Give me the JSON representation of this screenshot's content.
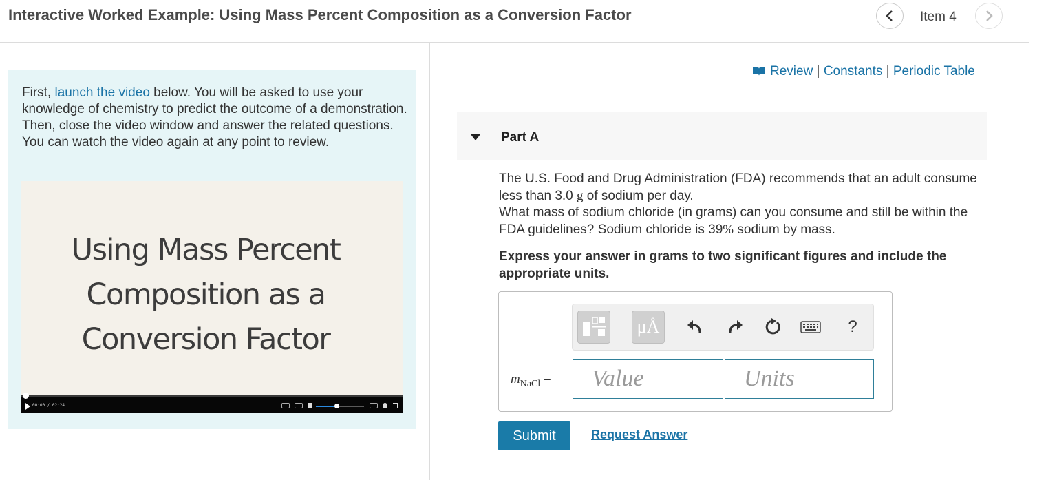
{
  "header": {
    "title": "Interactive Worked Example: Using Mass Percent Composition as a Conversion Factor",
    "item_label": "Item 4",
    "prev_icon": "chevron-left-icon",
    "next_icon": "chevron-right-icon"
  },
  "intro": {
    "text_before_link": "First, ",
    "link_text": "launch the video",
    "text_after_link": " below. You will be asked to use your knowledge of chemistry to predict the outcome of a demonstration. Then, close the video window and answer the related questions. You can watch the video again at any point to review."
  },
  "video": {
    "title_line1": "Using Mass Percent",
    "title_line2": "Composition as a",
    "title_line3": "Conversion Factor",
    "time": "00:00 / 02:24",
    "progress": 0.0,
    "volume": 0.43
  },
  "resources": {
    "icon": "book-icon",
    "review": "Review",
    "constants": "Constants",
    "periodic_table": "Periodic Table",
    "separator": "|"
  },
  "part": {
    "title": "Part A",
    "caret_icon": "caret-down-icon"
  },
  "question": {
    "line1_pre": "The U.S. Food and Drug Administration (FDA) recommends that an adult consume less than 3.0 ",
    "unit_g": "g",
    "line1_post": " of sodium per day.",
    "line2_pre": "What mass of sodium chloride (in grams) can you consume and still be within the FDA guidelines? Sodium chloride is 39",
    "percent": "%",
    "line2_post": " sodium by mass."
  },
  "instruction": "Express your answer in grams to two significant figures and include the appropriate units.",
  "toolbar": {
    "units_label": "μÅ",
    "help_label": "?",
    "icons": [
      "templates-icon",
      "units-icon",
      "undo-icon",
      "redo-icon",
      "reset-icon",
      "keyboard-icon",
      "help-icon"
    ]
  },
  "answer": {
    "var_symbol": "m",
    "var_subscript": "NaCl",
    "equals": "=",
    "value_placeholder": "Value",
    "units_placeholder": "Units"
  },
  "actions": {
    "submit_label": "Submit",
    "request_label": "Request Answer"
  },
  "colors": {
    "link": "#1a73a6",
    "submit_bg": "#1a7ba8",
    "intro_bg": "#e6f5f7",
    "field_border": "#2f7f99"
  }
}
